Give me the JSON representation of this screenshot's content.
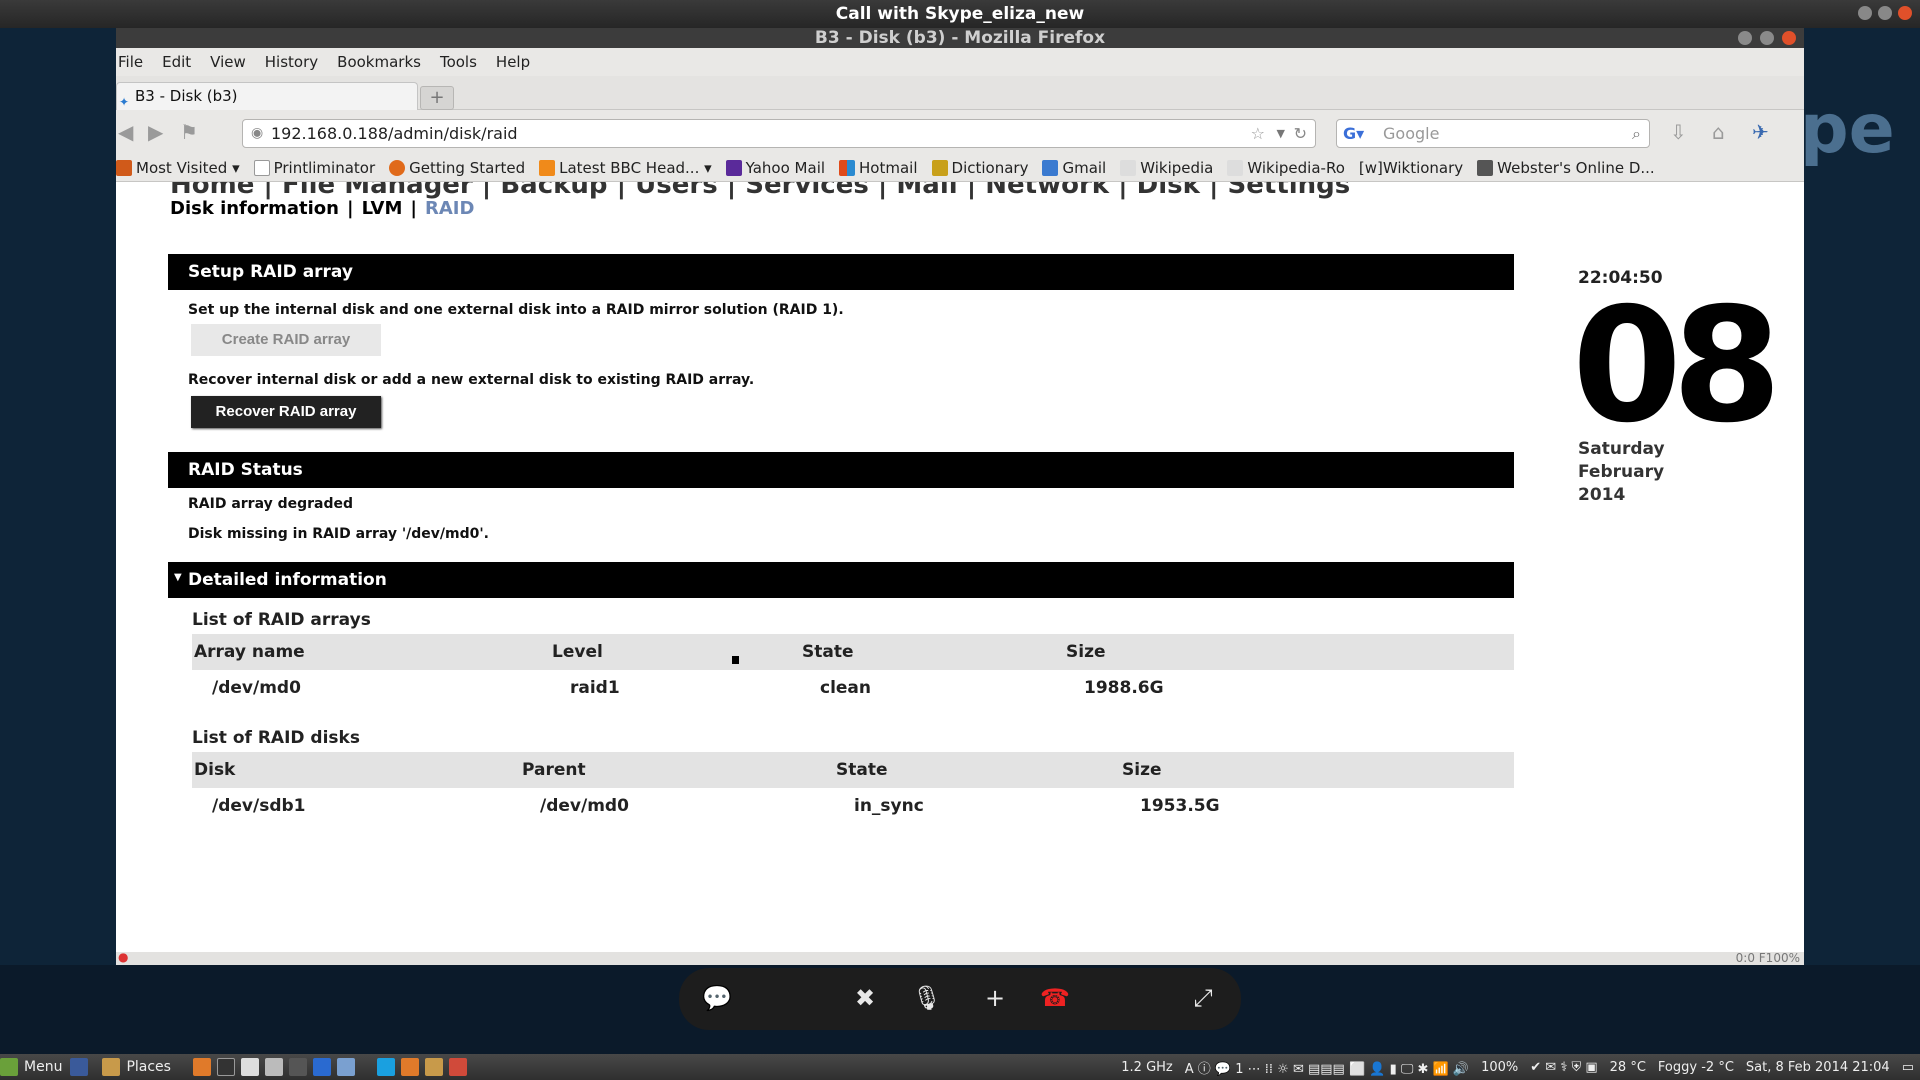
{
  "skype": {
    "title": "Call with Skype_eliza_new"
  },
  "firefox": {
    "window_title": "B3 - Disk (b3) - Mozilla Firefox",
    "menu": [
      "File",
      "Edit",
      "View",
      "History",
      "Bookmarks",
      "Tools",
      "Help"
    ],
    "tab_title": "B3 - Disk (b3)",
    "url": "192.168.0.188/admin/disk/raid",
    "search_placeholder": "Google",
    "bookmarks": [
      {
        "label": "Most Visited ▾",
        "color": "#d05a1a"
      },
      {
        "label": "Printliminator",
        "color": "#ffffff"
      },
      {
        "label": "Getting Started",
        "color": "#e06a1a"
      },
      {
        "label": "Latest BBC Head... ▾",
        "color": "#f08a1a"
      },
      {
        "label": "Yahoo Mail",
        "color": "#5a2a9a"
      },
      {
        "label": "Hotmail",
        "color": "#2a8ad0"
      },
      {
        "label": "Dictionary",
        "color": "#c8a01a"
      },
      {
        "label": "Gmail",
        "color": "#3a7ad0"
      },
      {
        "label": "Wikipedia",
        "color": "#333333"
      },
      {
        "label": "Wikipedia-Ro",
        "color": "#333333"
      },
      {
        "label": "[w]Wiktionary",
        "color": "#333333"
      },
      {
        "label": "Webster's Online D...",
        "color": "#555555"
      }
    ]
  },
  "page": {
    "topnav_clipped": "Home | File Manager | Backup | Users | Services | Mail | Network | Disk | Settings",
    "subnav": {
      "disk_info": "Disk information",
      "lvm": "LVM",
      "raid": "RAID",
      "sep": "|"
    },
    "setup": {
      "title": "Setup RAID array",
      "desc": "Set up the internal disk and one external disk into a RAID mirror solution (RAID 1).",
      "create_btn": "Create RAID array",
      "recover_desc": "Recover internal disk or add a new external disk to existing RAID array.",
      "recover_btn": "Recover RAID array"
    },
    "status": {
      "title": "RAID Status",
      "line1": "RAID array degraded",
      "line2": "Disk missing in RAID array '/dev/md0'."
    },
    "detail": {
      "title": "Detailed information",
      "arrays_title": "List of RAID arrays",
      "arrays_headers": [
        "Array name",
        "Level",
        "State",
        "Size"
      ],
      "arrays_rows": [
        [
          "/dev/md0",
          "raid1",
          "clean",
          "1988.6G"
        ]
      ],
      "disks_title": "List of RAID disks",
      "disks_headers": [
        "Disk",
        "Parent",
        "State",
        "Size"
      ],
      "disks_rows": [
        [
          "/dev/sdb1",
          "/dev/md0",
          "in_sync",
          "1953.5G"
        ]
      ]
    },
    "clock": {
      "time": "22:04:50",
      "day": "08",
      "weekday": "Saturday",
      "month": "February",
      "year": "2014"
    }
  },
  "statusbar": {
    "right": "0:0   F100%"
  },
  "taskbar": {
    "menu": "Menu",
    "places": "Places",
    "cpu": "1.2 GHz",
    "battery": "100%",
    "temp": "28 °C",
    "weather": "Foggy -2 °C",
    "datetime": "Sat,  8 Feb 2014 21:04"
  }
}
